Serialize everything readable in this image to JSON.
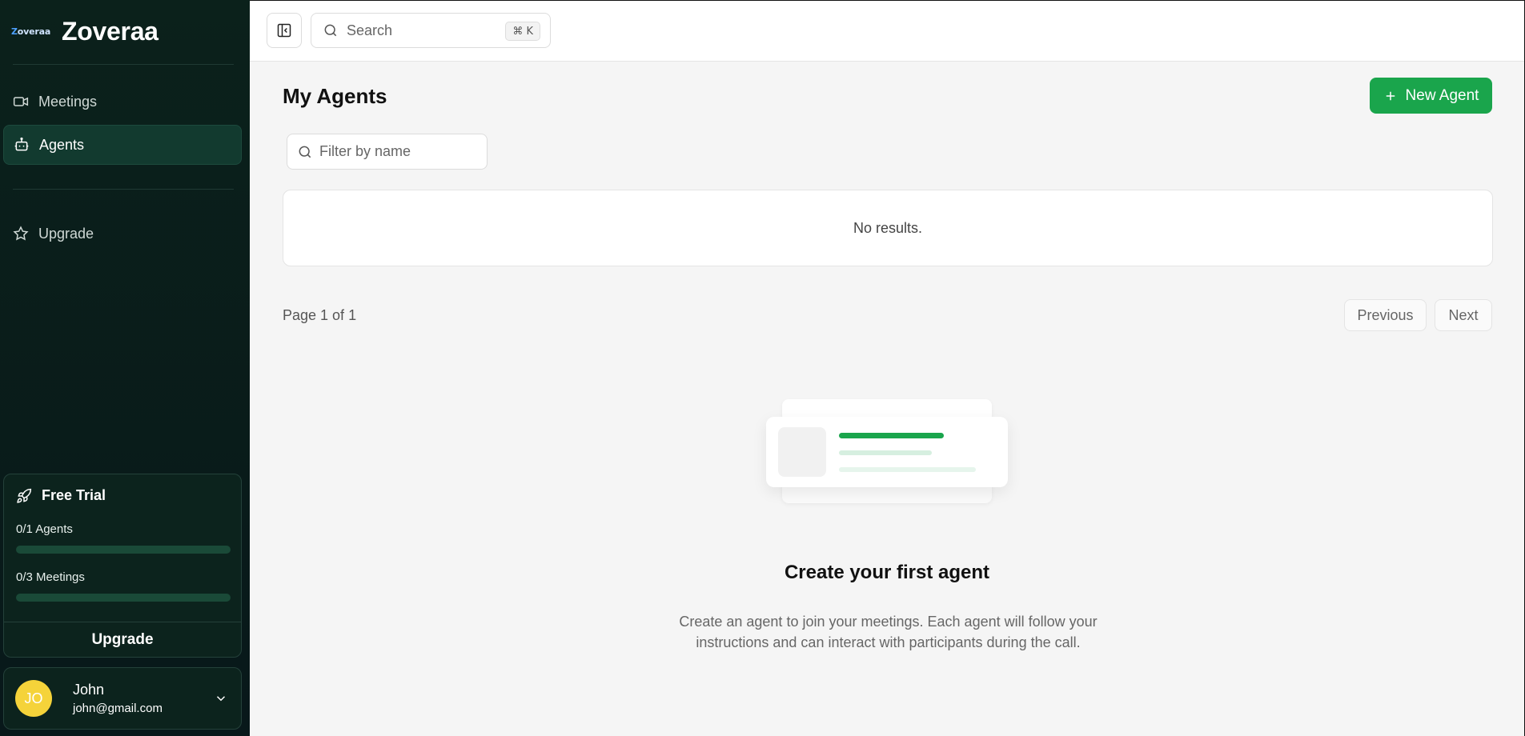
{
  "sidebar": {
    "logo_text": "Zoveraa",
    "brand_name": "Zoveraa",
    "nav": [
      {
        "label": "Meetings",
        "icon": "video-icon",
        "active": false
      },
      {
        "label": "Agents",
        "icon": "bot-icon",
        "active": true
      }
    ],
    "upgrade_label": "Upgrade",
    "trial": {
      "title": "Free Trial",
      "agents_label": "0/1 Agents",
      "agents_progress": 0,
      "meetings_label": "0/3 Meetings",
      "meetings_progress": 0,
      "upgrade_button": "Upgrade"
    },
    "user": {
      "initials": "JO",
      "name": "John",
      "email": "john@gmail.com"
    }
  },
  "topbar": {
    "search_placeholder": "Search",
    "shortcut": "⌘ K"
  },
  "main": {
    "title": "My Agents",
    "new_agent_label": "New Agent",
    "filter_placeholder": "Filter by name",
    "no_results": "No results.",
    "page_info": "Page 1 of 1",
    "previous_label": "Previous",
    "next_label": "Next",
    "empty_title": "Create your first agent",
    "empty_description": "Create an agent to join your meetings. Each agent will follow your instructions and can interact with participants during the call."
  },
  "colors": {
    "accent": "#1aa54c",
    "sidebar_bg": "#0b211b",
    "avatar": "#f5d33a"
  }
}
